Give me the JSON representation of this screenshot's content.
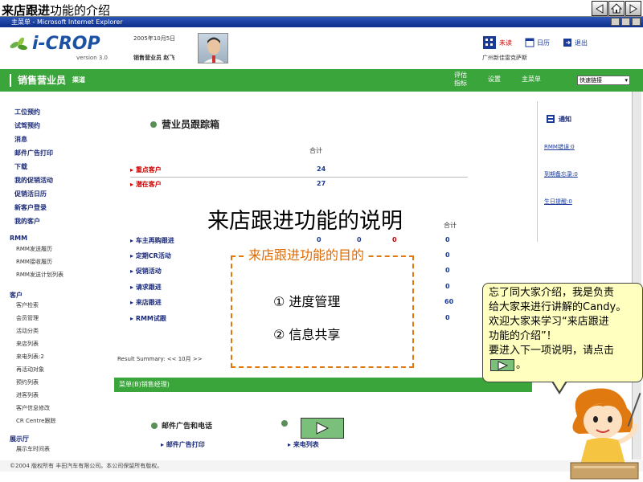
{
  "slide": {
    "title_bold": "来店跟进",
    "title_rest": "功能的介绍"
  },
  "window": {
    "title": "主菜单 - Microsoft Internet Explorer"
  },
  "app": {
    "logo": "i-CROP",
    "version": "version 3.0",
    "date": "2005年10月5日",
    "user": "销售营业员 赵飞",
    "header_links": [
      "未读",
      "日历",
      "退出"
    ],
    "company": "广州新佳雷克萨斯"
  },
  "nav": {
    "role": "销售营业员",
    "sub": "渠道",
    "items": [
      "评估\n指标",
      "设置",
      "主菜单"
    ],
    "quick_select": "快速链接"
  },
  "sidebar": {
    "top_items": [
      "工位预约",
      "试驾预约",
      "消息",
      "邮件广告打印",
      "下载",
      "我的促销活动",
      "促销活日历",
      "新客户登录",
      "我的客户"
    ],
    "rmm_head": "RMM",
    "rmm_items": [
      "RMM发送履历",
      "RMM接收履历",
      "RMM发送计划列表"
    ],
    "customer_head": "客户",
    "customer_items": [
      "客户检索",
      "会员管理",
      "活动分类",
      "来店列表",
      "来电列表:2",
      "再活动对象",
      "预约列表",
      "进客列表",
      "客户信息修改",
      "CR Centre跟踪"
    ],
    "showroom_head": "展示厅",
    "showroom_items": [
      "展示车时间表"
    ]
  },
  "main": {
    "tracker_title": "营业员跟踪箱",
    "col_total": "合计",
    "rows_top": [
      {
        "label": "重点客户",
        "value": "24"
      },
      {
        "label": "潜在客户",
        "value": "27"
      }
    ],
    "rows_bottom": [
      {
        "label": "车主再购跟进",
        "v1": "0",
        "v2": "0",
        "v3": "0",
        "total": "0"
      },
      {
        "label": "定期CR活动",
        "v1": "",
        "v2": "",
        "v3": "",
        "total": "0"
      },
      {
        "label": "促销活动",
        "v1": "",
        "v2": "",
        "v3": "",
        "total": "0"
      },
      {
        "label": "请求跟进",
        "v1": "",
        "v2": "",
        "v3": "",
        "total": "0"
      },
      {
        "label": "来店跟进",
        "v1": "",
        "v2": "",
        "v3": "",
        "total": "60"
      },
      {
        "label": "RMM试跟",
        "v1": "",
        "v2": "",
        "v3": "",
        "total": "0"
      }
    ],
    "result_summary": "Result Summary:  <<  10月  >>",
    "green_bar": "菜单(B)销售经理)",
    "sec1_title": "邮件广告和电话",
    "sec1_link": "邮件广告打印",
    "sec2_title": "?",
    "sec2_link": "来电列表"
  },
  "right_panel": {
    "head": "通知",
    "links": [
      "RMM错误:0",
      "到期备忘录:0",
      "生日提醒:0"
    ]
  },
  "footer": "©2004 版权所有 丰田汽车有限公司。本公司保留所有版权。",
  "overlay": {
    "big_title": "来店跟进功能的说明",
    "purpose_title": "来店跟进功能的目的",
    "purpose_items": [
      "①  进度管理",
      "②  信息共享"
    ],
    "bubble_lines": [
      "忘了同大家介绍，我是负责",
      "给大家来进行讲解的Candy。",
      "欢迎大家来学习“来店跟进",
      "功能的介绍”！",
      "要进入下一项说明，请点击"
    ],
    "bubble_end": "。"
  },
  "colors": {
    "green": "#3aa53a",
    "accent_orange": "#e06a00",
    "bubble_bg": "#ffffc0"
  }
}
